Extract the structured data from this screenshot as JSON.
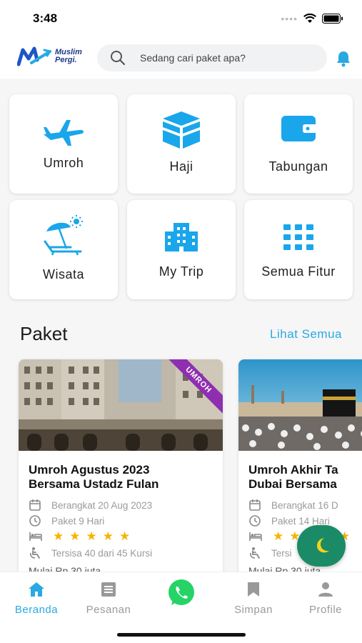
{
  "status": {
    "time": "3:48"
  },
  "logo": {
    "line1": "Muslim",
    "line2": "Pergi."
  },
  "search": {
    "placeholder": "Sedang cari paket apa?"
  },
  "features": [
    {
      "label": "Umroh",
      "icon": "airplane-icon"
    },
    {
      "label": "Haji",
      "icon": "kaaba-icon"
    },
    {
      "label": "Tabungan",
      "icon": "wallet-icon"
    },
    {
      "label": "Wisata",
      "icon": "beach-icon"
    },
    {
      "label": "My Trip",
      "icon": "building-icon"
    },
    {
      "label": "Semua Fitur",
      "icon": "grid-icon"
    }
  ],
  "section": {
    "title": "Paket",
    "see_all": "Lihat Semua"
  },
  "packages": [
    {
      "badge": "UMROH",
      "title": "Umroh Agustus 2023\nBersama Ustadz Fulan",
      "depart": "Berangkat 20 Aug 2023",
      "duration": "Paket 9 Hari",
      "rating": 5,
      "seats": "Tersisa 40 dari 45 Kursi",
      "price": "Mulai Rp 30 juta"
    },
    {
      "title": "Umroh Akhir Ta\nDubai Bersama",
      "depart": "Berangkat 16 D",
      "duration": "Paket 14 Hari",
      "rating": 5,
      "seats": "Tersi",
      "price": "Mulai Rp 30 juta"
    }
  ],
  "nav": {
    "home": "Beranda",
    "orders": "Pesanan",
    "saved": "Simpan",
    "profile": "Profile"
  },
  "colors": {
    "accent": "#29a9e1",
    "ribbon": "#8e2fb0",
    "fab": "#1b8b67",
    "whatsapp": "#25d366",
    "star": "#f6b400"
  }
}
